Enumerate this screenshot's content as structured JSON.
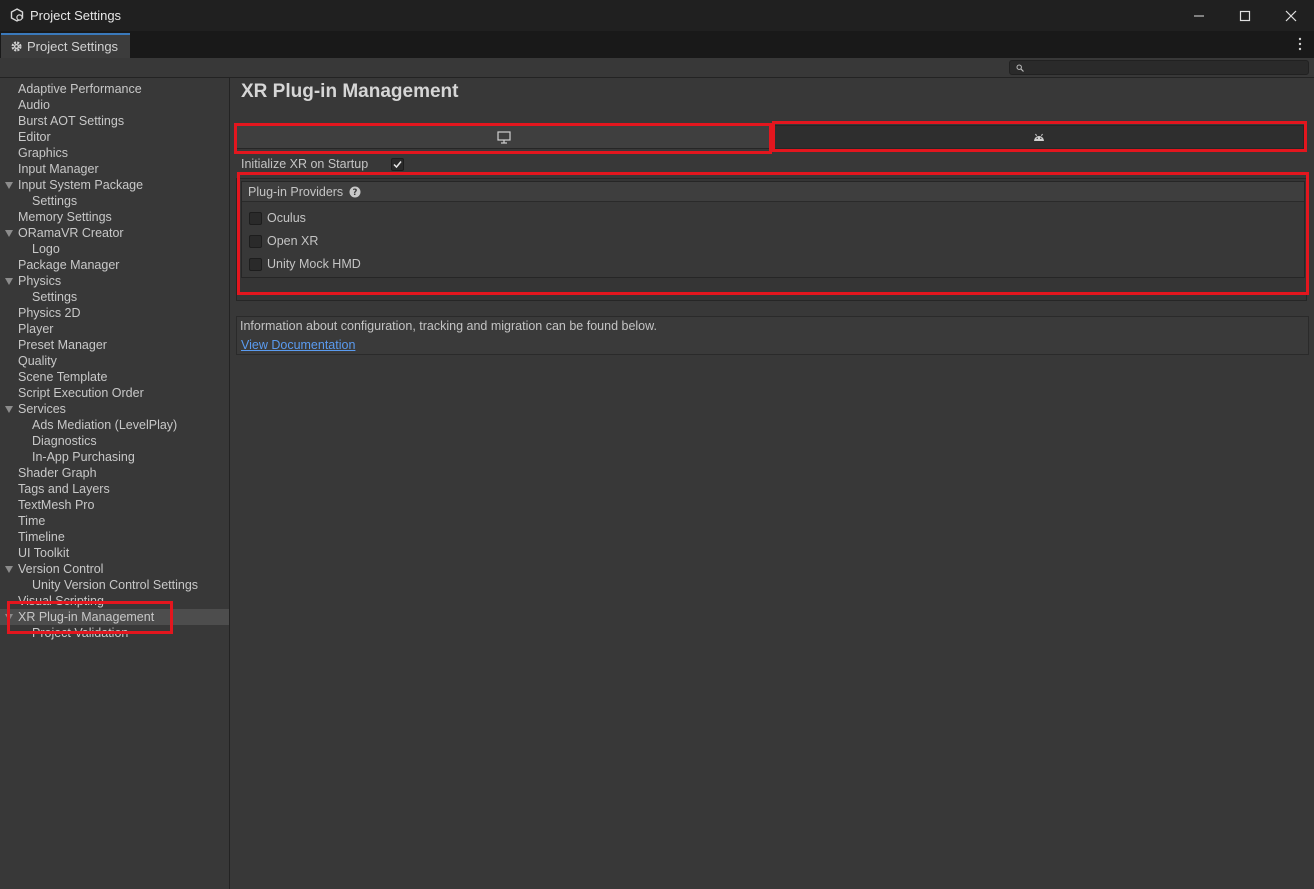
{
  "window": {
    "title": "Project Settings"
  },
  "tab": {
    "label": "Project Settings"
  },
  "search": {
    "placeholder": ""
  },
  "sidebar": {
    "items": [
      {
        "label": "Adaptive Performance",
        "level": 0,
        "expandable": false
      },
      {
        "label": "Audio",
        "level": 0,
        "expandable": false
      },
      {
        "label": "Burst AOT Settings",
        "level": 0,
        "expandable": false
      },
      {
        "label": "Editor",
        "level": 0,
        "expandable": false
      },
      {
        "label": "Graphics",
        "level": 0,
        "expandable": false
      },
      {
        "label": "Input Manager",
        "level": 0,
        "expandable": false
      },
      {
        "label": "Input System Package",
        "level": 0,
        "expandable": true
      },
      {
        "label": "Settings",
        "level": 1,
        "expandable": false
      },
      {
        "label": "Memory Settings",
        "level": 0,
        "expandable": false
      },
      {
        "label": "ORamaVR Creator",
        "level": 0,
        "expandable": true
      },
      {
        "label": "Logo",
        "level": 1,
        "expandable": false
      },
      {
        "label": "Package Manager",
        "level": 0,
        "expandable": false
      },
      {
        "label": "Physics",
        "level": 0,
        "expandable": true
      },
      {
        "label": "Settings",
        "level": 1,
        "expandable": false
      },
      {
        "label": "Physics 2D",
        "level": 0,
        "expandable": false
      },
      {
        "label": "Player",
        "level": 0,
        "expandable": false
      },
      {
        "label": "Preset Manager",
        "level": 0,
        "expandable": false
      },
      {
        "label": "Quality",
        "level": 0,
        "expandable": false
      },
      {
        "label": "Scene Template",
        "level": 0,
        "expandable": false
      },
      {
        "label": "Script Execution Order",
        "level": 0,
        "expandable": false
      },
      {
        "label": "Services",
        "level": 0,
        "expandable": true
      },
      {
        "label": "Ads Mediation (LevelPlay)",
        "level": 1,
        "expandable": false
      },
      {
        "label": "Diagnostics",
        "level": 1,
        "expandable": false
      },
      {
        "label": "In-App Purchasing",
        "level": 1,
        "expandable": false
      },
      {
        "label": "Shader Graph",
        "level": 0,
        "expandable": false
      },
      {
        "label": "Tags and Layers",
        "level": 0,
        "expandable": false
      },
      {
        "label": "TextMesh Pro",
        "level": 0,
        "expandable": false
      },
      {
        "label": "Time",
        "level": 0,
        "expandable": false
      },
      {
        "label": "Timeline",
        "level": 0,
        "expandable": false
      },
      {
        "label": "UI Toolkit",
        "level": 0,
        "expandable": false
      },
      {
        "label": "Version Control",
        "level": 0,
        "expandable": true
      },
      {
        "label": "Unity Version Control Settings",
        "level": 1,
        "expandable": false
      },
      {
        "label": "Visual Scripting",
        "level": 0,
        "expandable": false
      },
      {
        "label": "XR Plug-in Management",
        "level": 0,
        "expandable": true,
        "selected": true
      },
      {
        "label": "Project Validation",
        "level": 1,
        "expandable": false
      }
    ]
  },
  "main": {
    "title": "XR Plug-in Management",
    "platform_tabs": [
      {
        "icon": "monitor-icon",
        "selected": true
      },
      {
        "icon": "android-icon",
        "selected": false
      }
    ],
    "init_xr": {
      "label": "Initialize XR on Startup",
      "checked": true
    },
    "providers": {
      "header": "Plug-in Providers",
      "items": [
        {
          "label": "Oculus",
          "checked": false
        },
        {
          "label": "Open XR",
          "checked": false
        },
        {
          "label": "Unity Mock HMD",
          "checked": false
        }
      ]
    },
    "info": {
      "text": "Information about configuration, tracking and migration can be found below.",
      "link": "View Documentation"
    }
  },
  "colors": {
    "highlight": "#e3161e",
    "link": "#5a9bf0",
    "tab_accent": "#3a79bb"
  }
}
